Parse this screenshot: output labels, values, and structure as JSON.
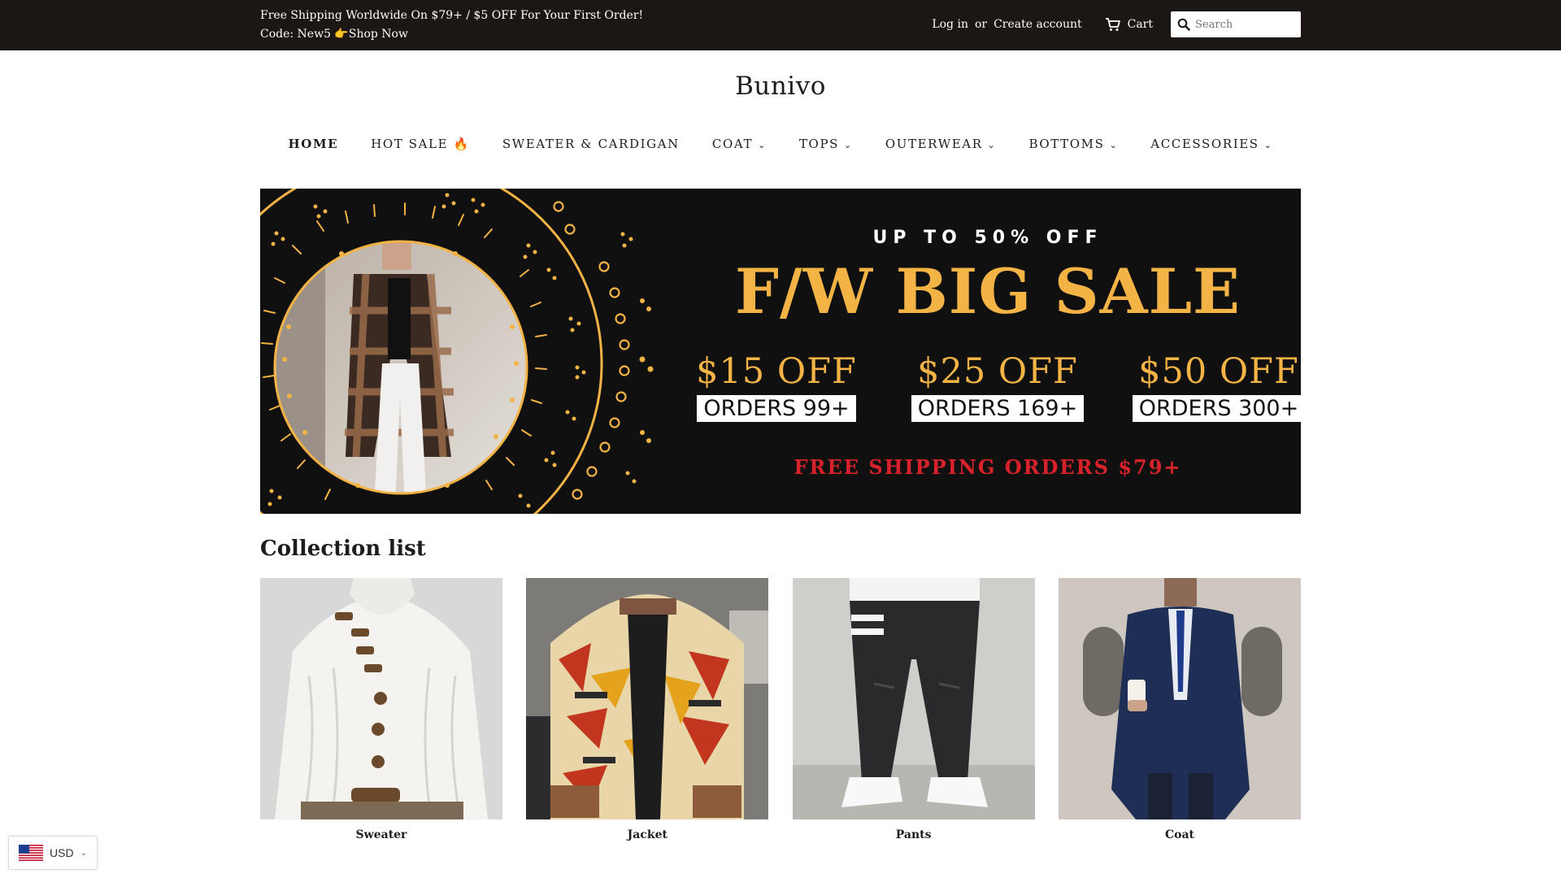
{
  "announcement": {
    "line1": "Free Shipping Worldwide On $79+ / $5 OFF For Your First Order!",
    "line2": "Code: New5 👉Shop Now"
  },
  "account": {
    "login": "Log in",
    "or": "or",
    "create": "Create account"
  },
  "cart": {
    "label": "Cart"
  },
  "search": {
    "placeholder": "Search"
  },
  "logo": "Bunivo",
  "nav": {
    "items": [
      {
        "label": "HOME"
      },
      {
        "label": "HOT SALE 🔥"
      },
      {
        "label": "SWEATER & CARDIGAN"
      },
      {
        "label": "COAT"
      },
      {
        "label": "TOPS"
      },
      {
        "label": "OUTERWEAR"
      },
      {
        "label": "BOTTOMS"
      },
      {
        "label": "ACCESSORIES"
      }
    ]
  },
  "hero": {
    "upto": "UP TO 50% OFF",
    "headline": "F/W BIG SALE",
    "offers": [
      {
        "amount": "$15 OFF",
        "condition": "ORDERS 99+"
      },
      {
        "amount": "$25 OFF",
        "condition": "ORDERS 169+"
      },
      {
        "amount": "$50 OFF",
        "condition": "ORDERS 300+"
      }
    ],
    "free_shipping": "FREE SHIPPING ORDERS $79+",
    "accent_color": "#f3b345",
    "sale_red": "#d8222b"
  },
  "collection": {
    "title": "Collection list",
    "items": [
      {
        "label": "Sweater"
      },
      {
        "label": "Jacket"
      },
      {
        "label": "Pants"
      },
      {
        "label": "Coat"
      }
    ]
  },
  "currency": {
    "code": "USD"
  }
}
